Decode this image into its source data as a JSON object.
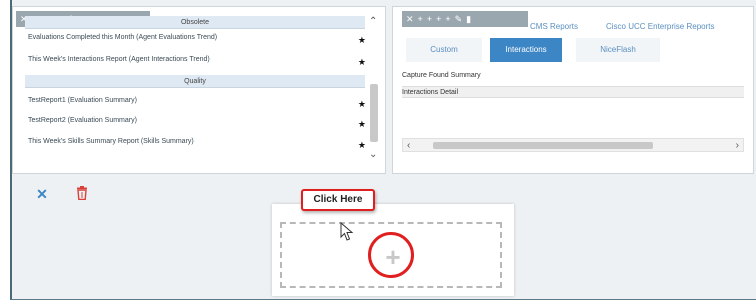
{
  "left_panel": {
    "toolbar_glyphs": [
      "✕",
      "+",
      "+",
      "+",
      "+",
      "✎",
      "▮"
    ],
    "section1_header": "Obsolete",
    "section1_rows": [
      "Evaluations Completed this Month (Agent Evaluations Trend)",
      "This Week's Interactions Report (Agent Interactions Trend)"
    ],
    "section2_header": "Quality",
    "section2_rows": [
      "TestReport1 (Evaluation Summary)",
      "TestReport2 (Evaluation Summary)",
      "This Week's Skills Summary Report (Skills Summary)"
    ],
    "star_glyph": "★"
  },
  "right_panel": {
    "toolbar_glyphs": [
      "✕",
      "+",
      "+",
      "+",
      "+",
      "✎",
      "▮"
    ],
    "top_links": [
      "CMS Reports",
      "Cisco UCC Enterprise Reports"
    ],
    "tabs": [
      "Custom",
      "Interactions",
      "NiceFlash"
    ],
    "active_tab": "Interactions",
    "rows": [
      "Capture Found Summary",
      "Interactions Detail"
    ]
  },
  "bottom": {
    "callout_text": "Click Here",
    "plus_glyph": "+"
  },
  "colors": {
    "accent": "#3d86c6",
    "callout_red": "#e02020",
    "trash_red": "#d8413a"
  },
  "icons": [
    "expand-icon",
    "trash-icon",
    "plus-icon",
    "star-icon",
    "chevron-up-icon",
    "chevron-down-icon",
    "chevron-left-icon",
    "chevron-right-icon",
    "cursor-icon"
  ]
}
